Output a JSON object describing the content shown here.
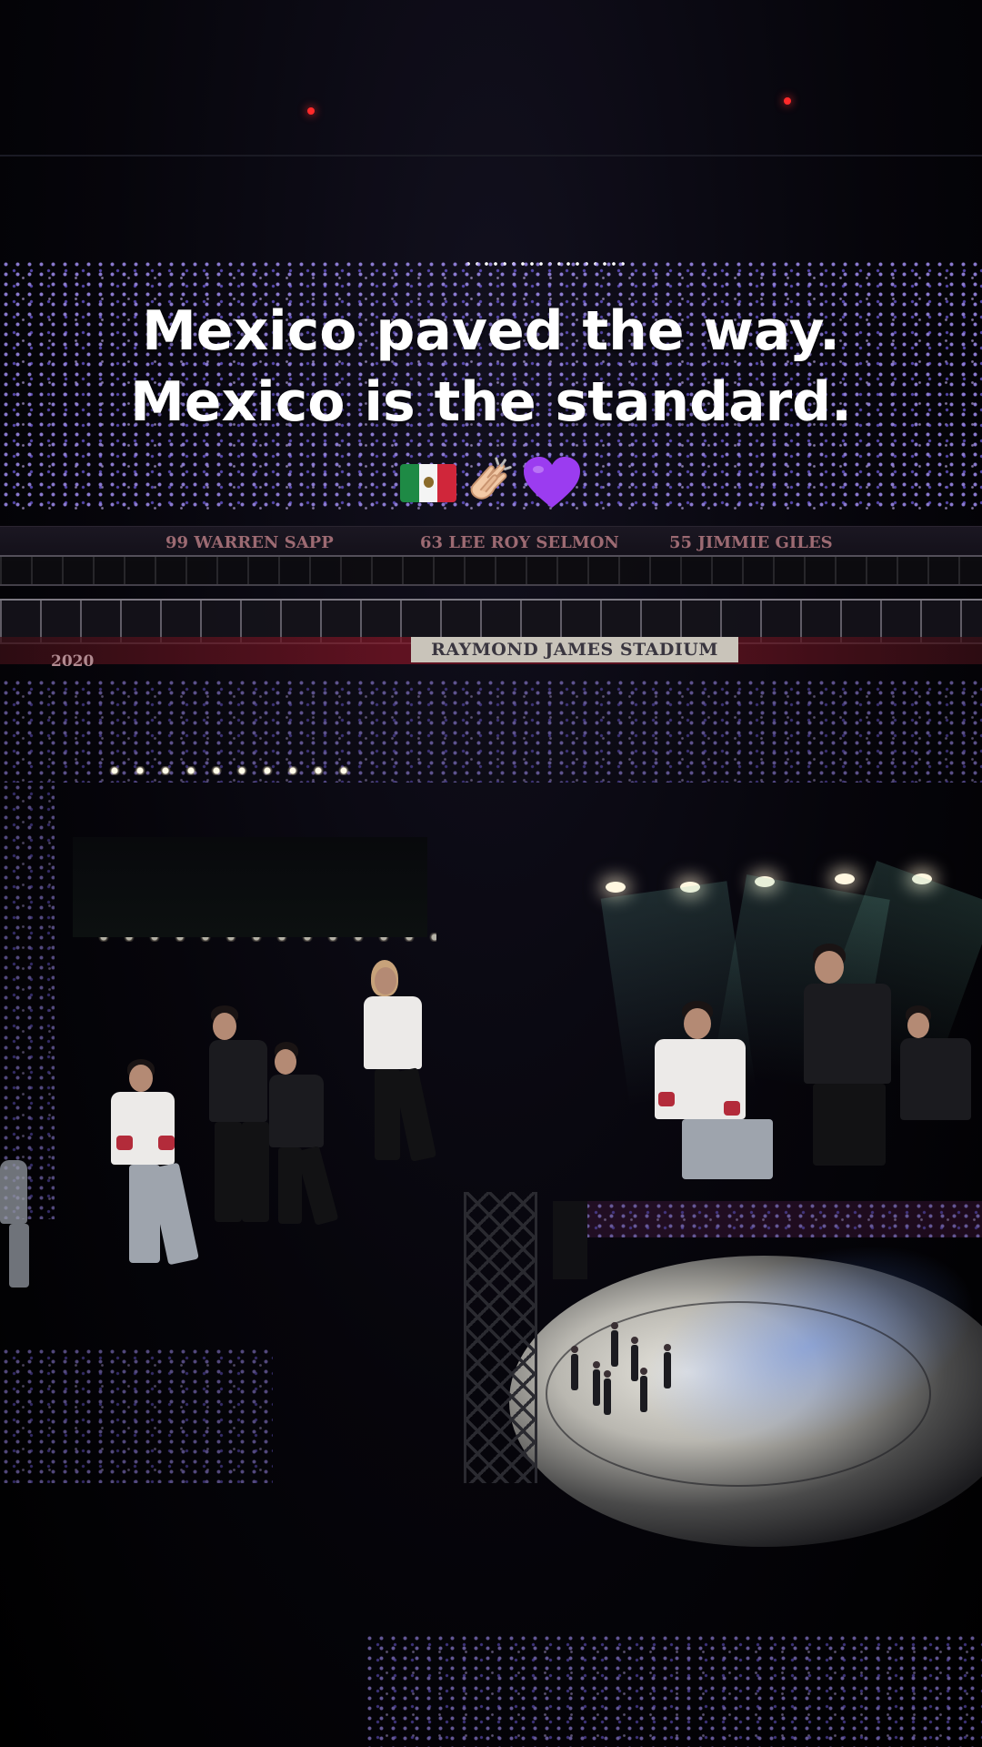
{
  "caption": {
    "line1": "Mexico paved the way.",
    "line2": "Mexico is the standard.",
    "emojis": [
      "mexico-flag-icon",
      "clapping-hands-icon",
      "purple-heart-icon"
    ]
  },
  "venue": {
    "stadium_sign": "RAYMOND JAMES STADIUM",
    "ring_of_honor": [
      "99 WARREN SAPP",
      "63 LEE ROY SELMON",
      "55 JIMMIE GILES"
    ],
    "year": "2020"
  },
  "colors": {
    "crowd_light": "#9a8cff",
    "heart": "#9b3cf0",
    "stadium_red": "#7a1424"
  }
}
